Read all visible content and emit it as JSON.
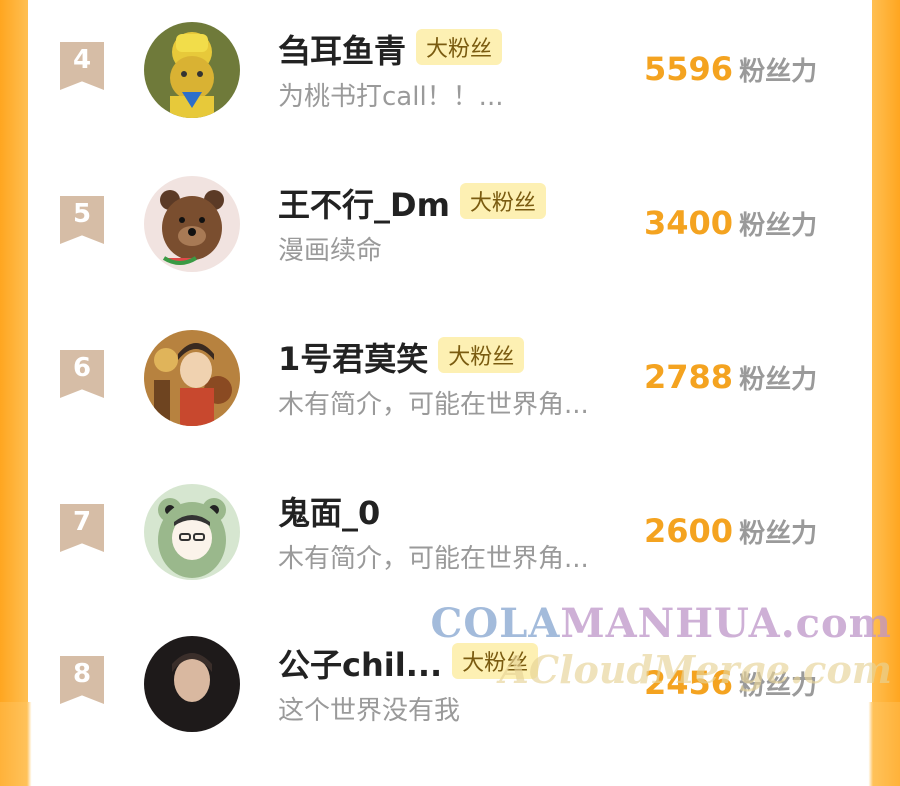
{
  "rows": [
    {
      "rank": "4",
      "name": "刍耳鱼青",
      "badge": "大粉丝",
      "bio": "为桃书打call！！...",
      "score": "5596",
      "unit": "粉丝力",
      "avatar": "yellow-teletubby-avatar"
    },
    {
      "rank": "5",
      "name": "王不行_Dm",
      "badge": "大粉丝",
      "bio": "漫画续命",
      "score": "3400",
      "unit": "粉丝力",
      "avatar": "bear-watermelon-avatar"
    },
    {
      "rank": "6",
      "name": "1号君莫笑",
      "badge": "大粉丝",
      "bio": "木有简介，可能在世界角...",
      "score": "2788",
      "unit": "粉丝力",
      "avatar": "anime-character-avatar"
    },
    {
      "rank": "7",
      "name": "鬼面_0",
      "badge": "",
      "bio": "木有简介，可能在世界角...",
      "score": "2600",
      "unit": "粉丝力",
      "avatar": "frog-hood-avatar"
    },
    {
      "rank": "8",
      "name": "公子chil...",
      "badge": "大粉丝",
      "bio": "这个世界没有我",
      "score": "2456",
      "unit": "粉丝力",
      "avatar": "dark-portrait-avatar"
    }
  ],
  "watermark": {
    "line1_a": "COLA",
    "line1_b": "MANHUA.com",
    "line2": "ACloudMerge.com"
  },
  "colors": {
    "accent": "#f4a320",
    "badge_bg": "#fdf0b3",
    "rank_bg": "#d6bda6",
    "frame": "#ffb23a"
  }
}
